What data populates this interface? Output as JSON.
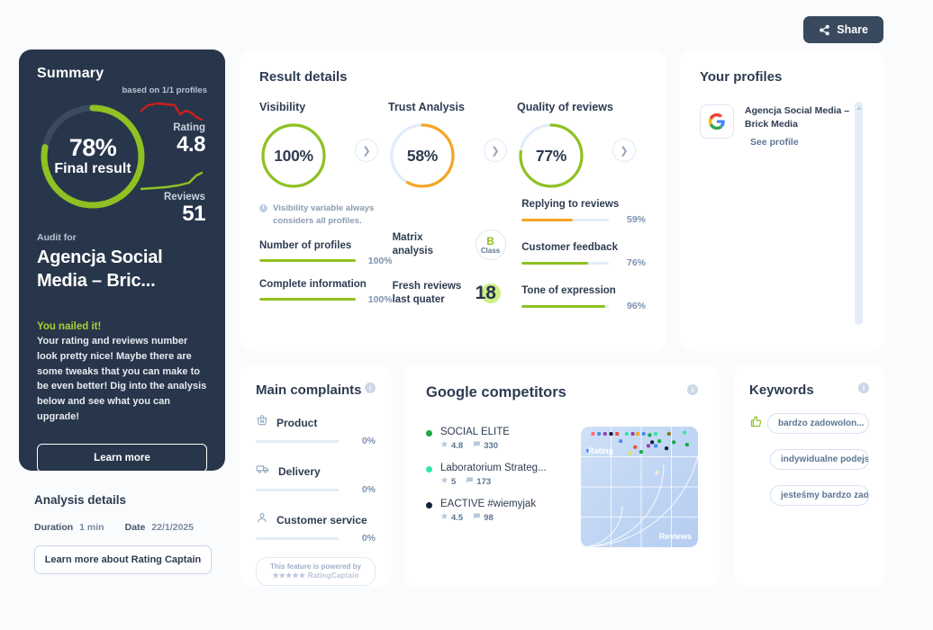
{
  "topbar": {
    "share_label": "Share"
  },
  "summary": {
    "title": "Summary",
    "based_on": "based on 1/1 profiles",
    "final_pct": "78%",
    "final_label": "Final result",
    "final_value": 78,
    "rating_label": "Rating",
    "rating_value": "4.8",
    "reviews_label": "Reviews",
    "reviews_value": "51",
    "audit_for_label": "Audit for",
    "audit_name": "Agencja Social Media – Bric...",
    "nailed_title": "You nailed it!",
    "nailed_body": "Your rating and reviews number look pretty nice! Maybe there are some tweaks that you can make to be even better! Dig into the analysis below and see what you can upgrade!",
    "learn_more": "Learn more"
  },
  "analysis": {
    "title": "Analysis details",
    "duration_key": "Duration",
    "duration_val": "1 min",
    "date_key": "Date",
    "date_val": "22/1/2025",
    "button": "Learn more about Rating Captain"
  },
  "result_details": {
    "title": "Result details",
    "gauges": [
      {
        "label": "Visibility",
        "pct": "100%",
        "value": 100,
        "color": "#8fc122"
      },
      {
        "label": "Trust Analysis",
        "pct": "58%",
        "value": 58,
        "color": "#f5a623"
      },
      {
        "label": "Quality of reviews",
        "pct": "77%",
        "value": 77,
        "color": "#8fc122"
      }
    ],
    "hint": "Visibility variable always considers all profiles.",
    "col_a": [
      {
        "label": "Number of profiles",
        "pct": "100%",
        "value": 100,
        "color": "#8fc122"
      },
      {
        "label": "Complete information",
        "pct": "100%",
        "value": 100,
        "color": "#8fc122"
      }
    ],
    "matrix_label": "Matrix analysis",
    "matrix_class_letter": "B",
    "matrix_class_word": "Class",
    "fresh_label": "Fresh reviews last quater",
    "fresh_value": "18",
    "col_c": [
      {
        "label": "Replying to reviews",
        "pct": "59%",
        "value": 59,
        "color": "#f5a623"
      },
      {
        "label": "Customer feedback",
        "pct": "76%",
        "value": 76,
        "color": "#8fc122"
      },
      {
        "label": "Tone of expression",
        "pct": "96%",
        "value": 96,
        "color": "#8fc122"
      }
    ]
  },
  "profiles": {
    "title": "Your profiles",
    "items": [
      {
        "name": "Agencja Social Media – Brick Media",
        "link": "See profile"
      }
    ]
  },
  "complaints": {
    "title": "Main complaints",
    "items": [
      {
        "icon": "basket-icon",
        "label": "Product",
        "pct": "0%",
        "value": 0
      },
      {
        "icon": "delivery-truck-icon",
        "label": "Delivery",
        "pct": "0%",
        "value": 0
      },
      {
        "icon": "person-icon",
        "label": "Customer service",
        "pct": "0%",
        "value": 0
      }
    ],
    "powered_line1": "This feature is powered by",
    "powered_line2": "★★★★★ RatingCaptain"
  },
  "competitors": {
    "title": "Google competitors",
    "items": [
      {
        "name": "SOCIAL ELITE",
        "rating": "4.8",
        "reviews": "330",
        "color": "#1ea64a"
      },
      {
        "name": "Laboratorium Strateg...",
        "rating": "5",
        "reviews": "173",
        "color": "#2ee8a5"
      },
      {
        "name": "EACTIVE #wiemyjak",
        "rating": "4.5",
        "reviews": "98",
        "color": "#12203a"
      }
    ],
    "chart_axis_y": "Rating",
    "chart_axis_x": "Reviews"
  },
  "keywords": {
    "title": "Keywords",
    "items": [
      "bardzo zadowolon...",
      "indywidualne podejsc...",
      "jesteśmy bardzo zado..."
    ]
  },
  "chart_data": {
    "type": "scatter",
    "title": "Google competitors matrix",
    "xlabel": "Reviews",
    "ylabel": "Rating",
    "xlim": [
      0,
      100
    ],
    "ylim": [
      0,
      100
    ],
    "grid": true,
    "legend": "none",
    "points": [
      {
        "x": 10,
        "y": 94,
        "c": "#ff6b6b"
      },
      {
        "x": 15,
        "y": 94,
        "c": "#4c8bf5"
      },
      {
        "x": 20,
        "y": 94,
        "c": "#8e44ad"
      },
      {
        "x": 25,
        "y": 94,
        "c": "#12203a"
      },
      {
        "x": 30,
        "y": 94,
        "c": "#e74c3c"
      },
      {
        "x": 38,
        "y": 94,
        "c": "#2ee8a5"
      },
      {
        "x": 43,
        "y": 94,
        "c": "#8e44ad"
      },
      {
        "x": 47,
        "y": 94,
        "c": "#f5a623"
      },
      {
        "x": 52,
        "y": 94,
        "c": "#4c8bf5"
      },
      {
        "x": 57,
        "y": 93,
        "c": "#1ea64a"
      },
      {
        "x": 62,
        "y": 94,
        "c": "#2ee8a5"
      },
      {
        "x": 73,
        "y": 94,
        "c": "#8b7a1f"
      },
      {
        "x": 86,
        "y": 95,
        "c": "#2ee8a5"
      },
      {
        "x": 33,
        "y": 88,
        "c": "#4c8bf5"
      },
      {
        "x": 59,
        "y": 87,
        "c": "#12203a"
      },
      {
        "x": 65,
        "y": 88,
        "c": "#1ea64a"
      },
      {
        "x": 77,
        "y": 87,
        "c": "#1ea64a"
      },
      {
        "x": 88,
        "y": 85,
        "c": "#1ea64a"
      },
      {
        "x": 45,
        "y": 83,
        "c": "#e74c3c"
      },
      {
        "x": 56,
        "y": 84,
        "c": "#8e44ad"
      },
      {
        "x": 62,
        "y": 84,
        "c": "#4c8bf5"
      },
      {
        "x": 71,
        "y": 82,
        "c": "#12203a"
      },
      {
        "x": 6,
        "y": 80,
        "c": "#4c8bf5"
      },
      {
        "x": 41,
        "y": 78,
        "c": "#e3e83a"
      },
      {
        "x": 50,
        "y": 79,
        "c": "#1ea64a"
      },
      {
        "x": 63,
        "y": 62,
        "c": "#f0ead2"
      }
    ]
  }
}
